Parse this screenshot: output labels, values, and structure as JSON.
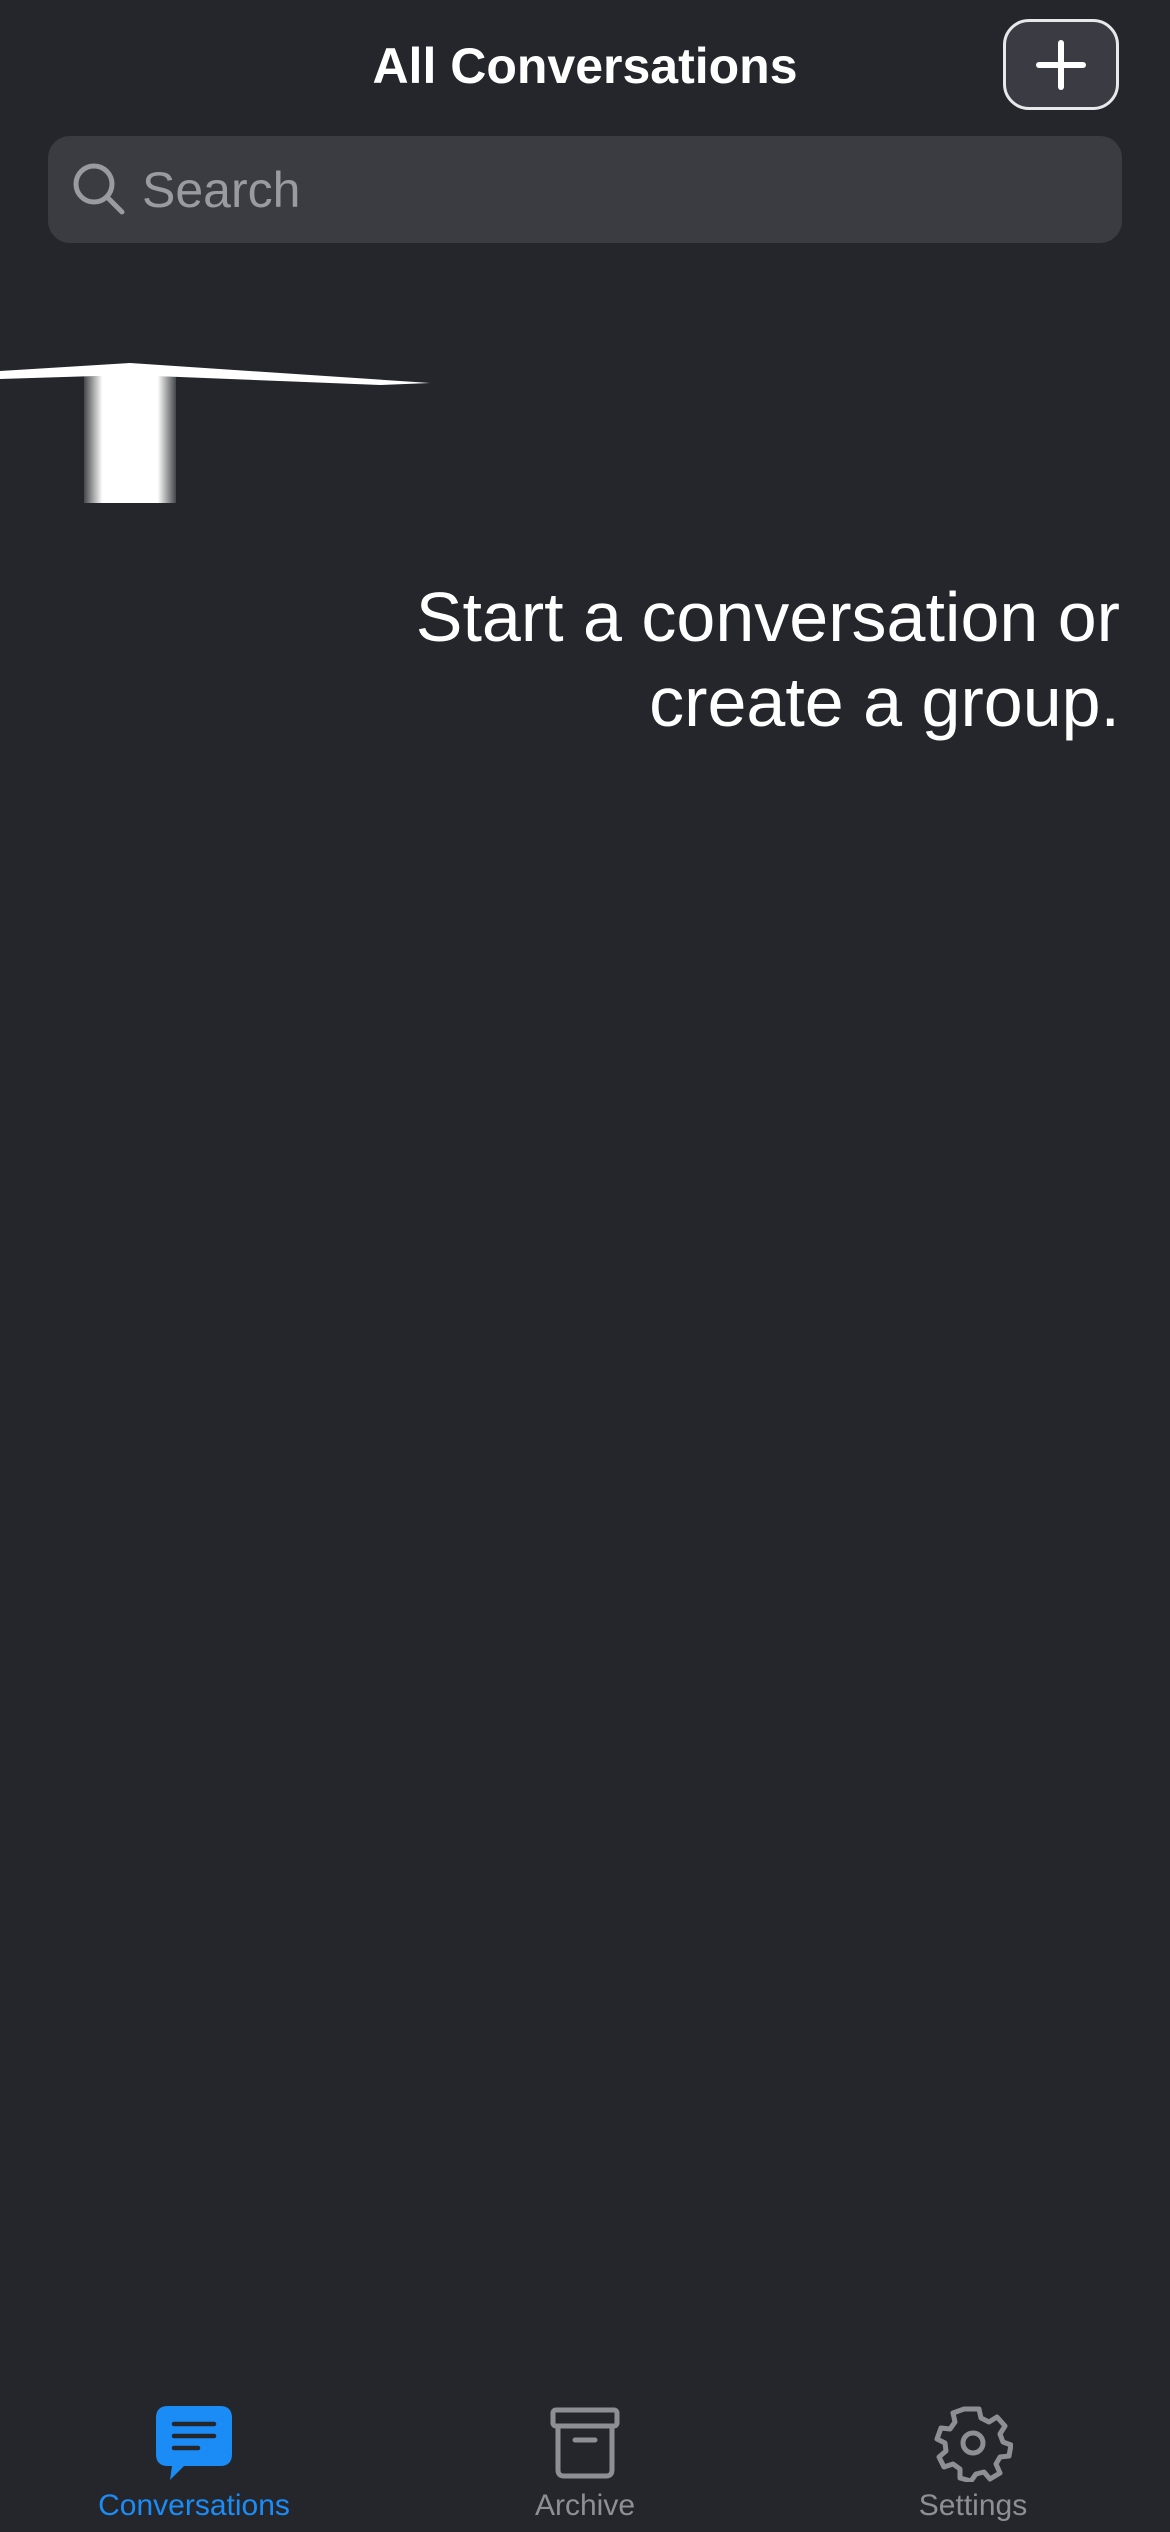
{
  "header": {
    "title": "All Conversations",
    "add_button_icon": "plus-icon"
  },
  "search": {
    "placeholder": "Search",
    "value": "",
    "icon": "search-icon"
  },
  "empty_state": {
    "line1": "Start a conversation or",
    "line2": "create a group."
  },
  "tabs": [
    {
      "label": "Conversations",
      "icon": "chat-bubble-icon",
      "active": true
    },
    {
      "label": "Archive",
      "icon": "archive-box-icon",
      "active": false
    },
    {
      "label": "Settings",
      "icon": "gear-icon",
      "active": false
    }
  ],
  "colors": {
    "background": "#25262b",
    "search_field": "#3b3c42",
    "accent": "#1b8cf6",
    "inactive_tab": "#8e8f95",
    "text": "#ffffff"
  }
}
